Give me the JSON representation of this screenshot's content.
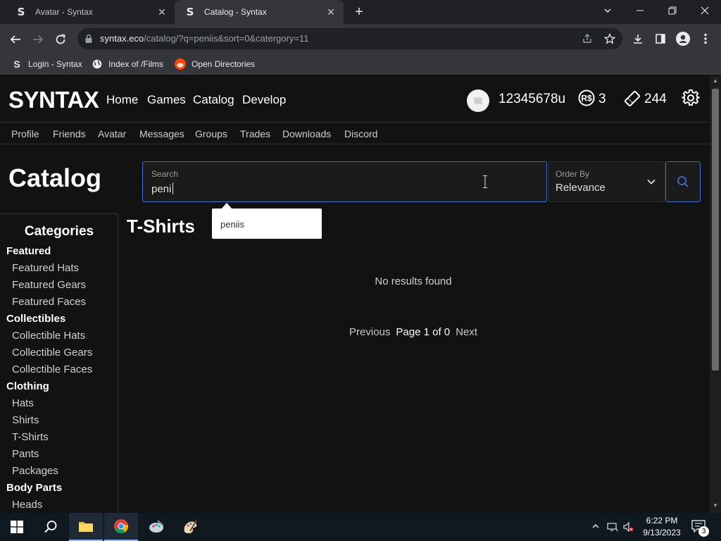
{
  "browser": {
    "tabs": [
      {
        "favicon": "S",
        "title": "Avatar - Syntax"
      },
      {
        "favicon": "S",
        "title": "Catalog - Syntax"
      }
    ],
    "new_tab": "+",
    "url_host": "syntax.eco",
    "url_path": "/catalog/?q=peniis&sort=0&catergory=11",
    "bookmarks": [
      {
        "label": "Login - Syntax",
        "icon": "S"
      },
      {
        "label": "Index of /Films",
        "icon": "globe-icon"
      },
      {
        "label": "Open Directories",
        "icon": "reddit-icon"
      }
    ]
  },
  "site": {
    "logo": "SYNTAX",
    "nav": [
      "Home",
      "Games",
      "Catalog",
      "Develop"
    ],
    "username": "12345678u",
    "robux": "3",
    "tix": "244",
    "subnav": [
      "Profile",
      "Friends",
      "Avatar",
      "Messages",
      "Groups",
      "Trades",
      "Downloads",
      "Discord"
    ]
  },
  "catalog": {
    "title": "Catalog",
    "search_label": "Search",
    "search_value": "peni",
    "order_label": "Order By",
    "order_value": "Relevance",
    "autocomplete": "peniis",
    "section_title": "T-Shirts",
    "no_results": "No results found",
    "pagination": {
      "prev": "Previous",
      "info": "Page 1 of 0",
      "next": "Next"
    }
  },
  "sidebar": {
    "title": "Categories",
    "groups": [
      {
        "head": "Featured",
        "items": [
          "Featured Hats",
          "Featured Gears",
          "Featured Faces"
        ]
      },
      {
        "head": "Collectibles",
        "items": [
          "Collectible Hats",
          "Collectible Gears",
          "Collectible Faces"
        ]
      },
      {
        "head": "Clothing",
        "items": [
          "Hats",
          "Shirts",
          "T-Shirts",
          "Pants",
          "Packages"
        ]
      },
      {
        "head": "Body Parts",
        "items": [
          "Heads"
        ]
      }
    ]
  },
  "taskbar": {
    "time": "6:22 PM",
    "date": "9/13/2023",
    "notifications": "3"
  },
  "colors": {
    "accent": "#3b6fd8",
    "page_bg": "#121212",
    "chrome_bg": "#35363a"
  }
}
